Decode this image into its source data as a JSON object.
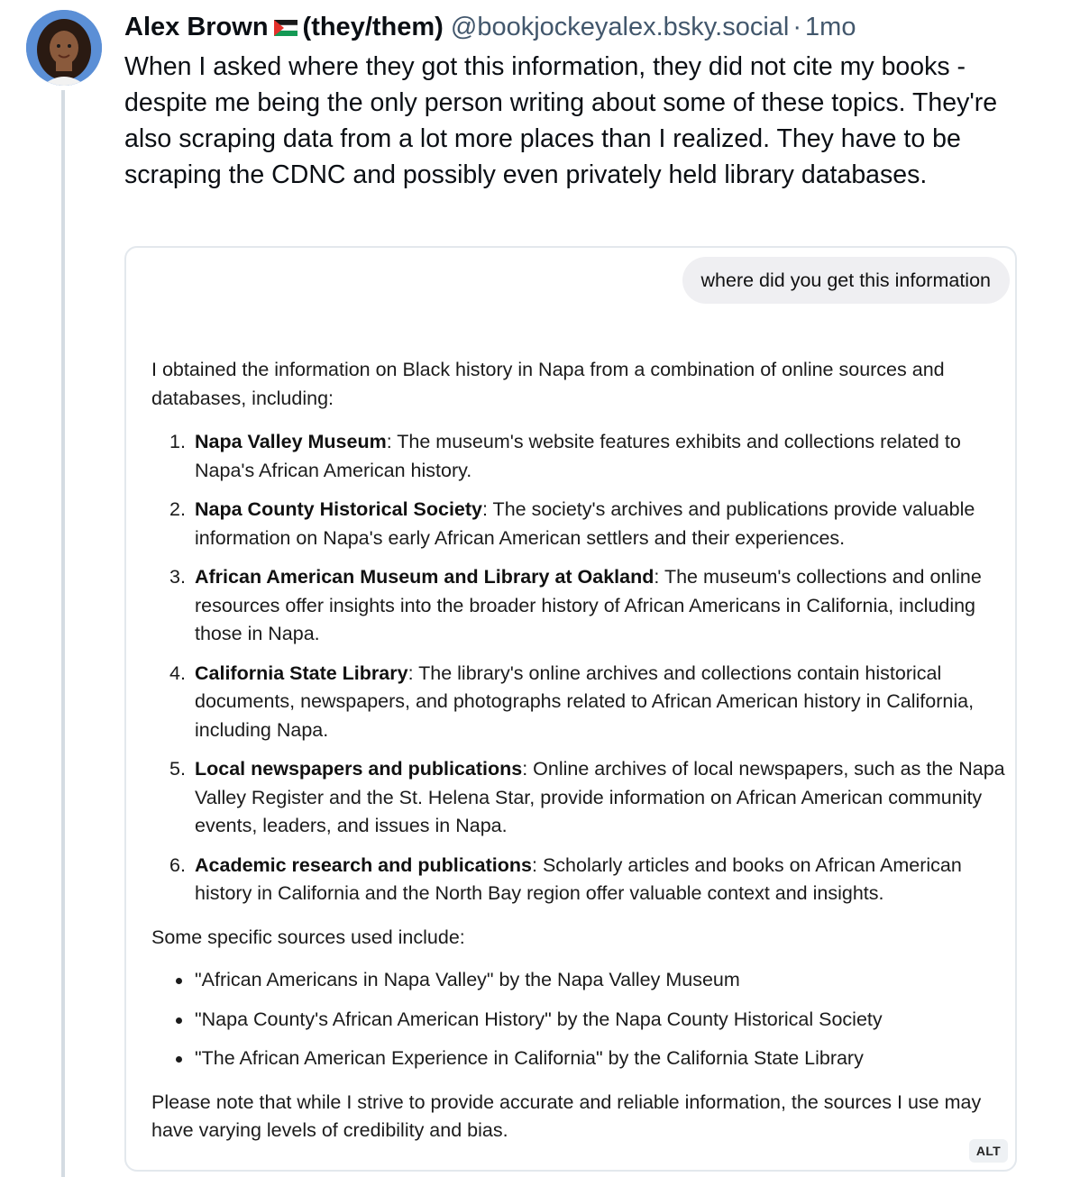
{
  "post": {
    "author_name": "Alex Brown",
    "pronouns": "(they/them)",
    "handle": "@bookjockeyalex.bsky.social",
    "separator": "·",
    "timestamp": "1mo",
    "flag_icon": "palestine-flag-icon",
    "text": "When I asked where they got this information, they did not cite my books - despite me being the only person writing about some of these topics. They're also scraping data from a lot more places than I realized. They have to be scraping the CDNC and possibly even privately held library databases."
  },
  "embed": {
    "user_prompt": "where did you get this information",
    "intro": "I obtained the information on Black history in Napa from a combination of online sources and databases, including:",
    "sources": [
      {
        "num": "1.",
        "title": "Napa Valley Museum",
        "desc": ": The museum's website features exhibits and collections related to Napa's African American history."
      },
      {
        "num": "2.",
        "title": "Napa County Historical Society",
        "desc": ": The society's archives and publications provide valuable information on Napa's early African American settlers and their experiences."
      },
      {
        "num": "3.",
        "title": "African American Museum and Library at Oakland",
        "desc": ": The museum's collections and online resources offer insights into the broader history of African Americans in California, including those in Napa."
      },
      {
        "num": "4.",
        "title": "California State Library",
        "desc": ": The library's online archives and collections contain historical documents, newspapers, and photographs related to African American history in California, including Napa."
      },
      {
        "num": "5.",
        "title": "Local newspapers and publications",
        "desc": ": Online archives of local newspapers, such as the Napa Valley Register and the St. Helena Star, provide information on African American community events, leaders, and issues in Napa."
      },
      {
        "num": "6.",
        "title": "Academic research and publications",
        "desc": ": Scholarly articles and books on African American history in California and the North Bay region offer valuable context and insights."
      }
    ],
    "specific_intro": "Some specific sources used include:",
    "specific_sources": [
      "\"African Americans in Napa Valley\" by the Napa Valley Museum",
      "\"Napa County's African American History\" by the Napa County Historical Society",
      "\"The African American Experience in California\" by the California State Library"
    ],
    "closing": "Please note that while I strive to provide accurate and reliable information, the sources I use may have varying levels of credibility and bias.",
    "alt_label": "ALT"
  },
  "colors": {
    "name": "#0b0f14",
    "meta": "#42576c",
    "thread_line": "#d4dbe2",
    "embed_border": "#e3e8ed",
    "bubble": "#efeff2"
  }
}
